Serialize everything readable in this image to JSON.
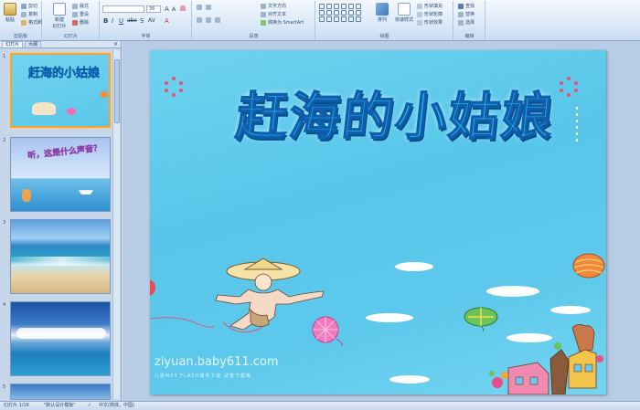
{
  "ribbon": {
    "clipboard": {
      "paste": "粘贴",
      "cut": "剪切",
      "copy": "复制",
      "format_painter": "格式刷",
      "label": "剪贴板"
    },
    "slides": {
      "new_slide": "新建\n幻灯片",
      "layout": "版式",
      "reset": "重设",
      "delete": "删除",
      "label": "幻灯片"
    },
    "font": {
      "font_name": "",
      "font_size": "36",
      "label": "字体"
    },
    "paragraph": {
      "text_direction": "文字方向",
      "align_text": "对齐文本",
      "convert_smartart": "转换为 SmartArt",
      "label": "段落"
    },
    "drawing": {
      "arrange": "排列",
      "quick_styles": "快速样式",
      "shape_fill": "形状填充",
      "shape_outline": "形状轮廓",
      "shape_effects": "形状效果",
      "label": "绘图"
    },
    "editing": {
      "find": "查找",
      "replace": "替换",
      "select": "选择",
      "label": "编辑"
    }
  },
  "left_pane": {
    "tab_slides": "幻灯片",
    "tab_outline": "大纲",
    "close": "×",
    "thumbs": [
      {
        "num": "1",
        "title": "赶海的小姑娘"
      },
      {
        "num": "2",
        "title": "听，这是什么声音？"
      },
      {
        "num": "3",
        "title": ""
      },
      {
        "num": "4",
        "title": ""
      },
      {
        "num": "5",
        "title": ""
      }
    ]
  },
  "slide": {
    "title": "赶海的小姑娘",
    "watermark": "ziyuan.baby611.com",
    "watermark_sub": "儿歌MP3  FLASH课件下载  试卷下载等"
  },
  "status": {
    "slide_count": "幻灯片 1/16",
    "theme": "\"默认设计模板\"",
    "language": "中文(简体，中国)"
  },
  "colors": {
    "accent": "#2fb6e8",
    "title_stroke": "#0d5fae",
    "selected_border": "#f3a53a"
  }
}
